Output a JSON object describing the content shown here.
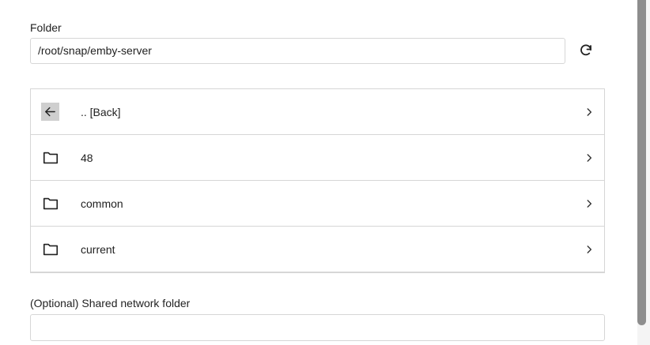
{
  "folder": {
    "label": "Folder",
    "value": "/root/snap/emby-server",
    "refresh_icon": "refresh-icon"
  },
  "browser": {
    "items": [
      {
        "label": ".. [Back]",
        "icon": "arrow-left-icon"
      },
      {
        "label": "48",
        "icon": "folder-icon"
      },
      {
        "label": "common",
        "icon": "folder-icon"
      },
      {
        "label": "current",
        "icon": "folder-icon"
      }
    ],
    "chevron_icon": "chevron-right-icon"
  },
  "shared": {
    "label": "(Optional) Shared network folder",
    "value": ""
  },
  "colors": {
    "border": "#d6d6d6",
    "back_icon_bg": "#cfcfcf",
    "scrollbar_thumb": "#8d8d8d"
  }
}
